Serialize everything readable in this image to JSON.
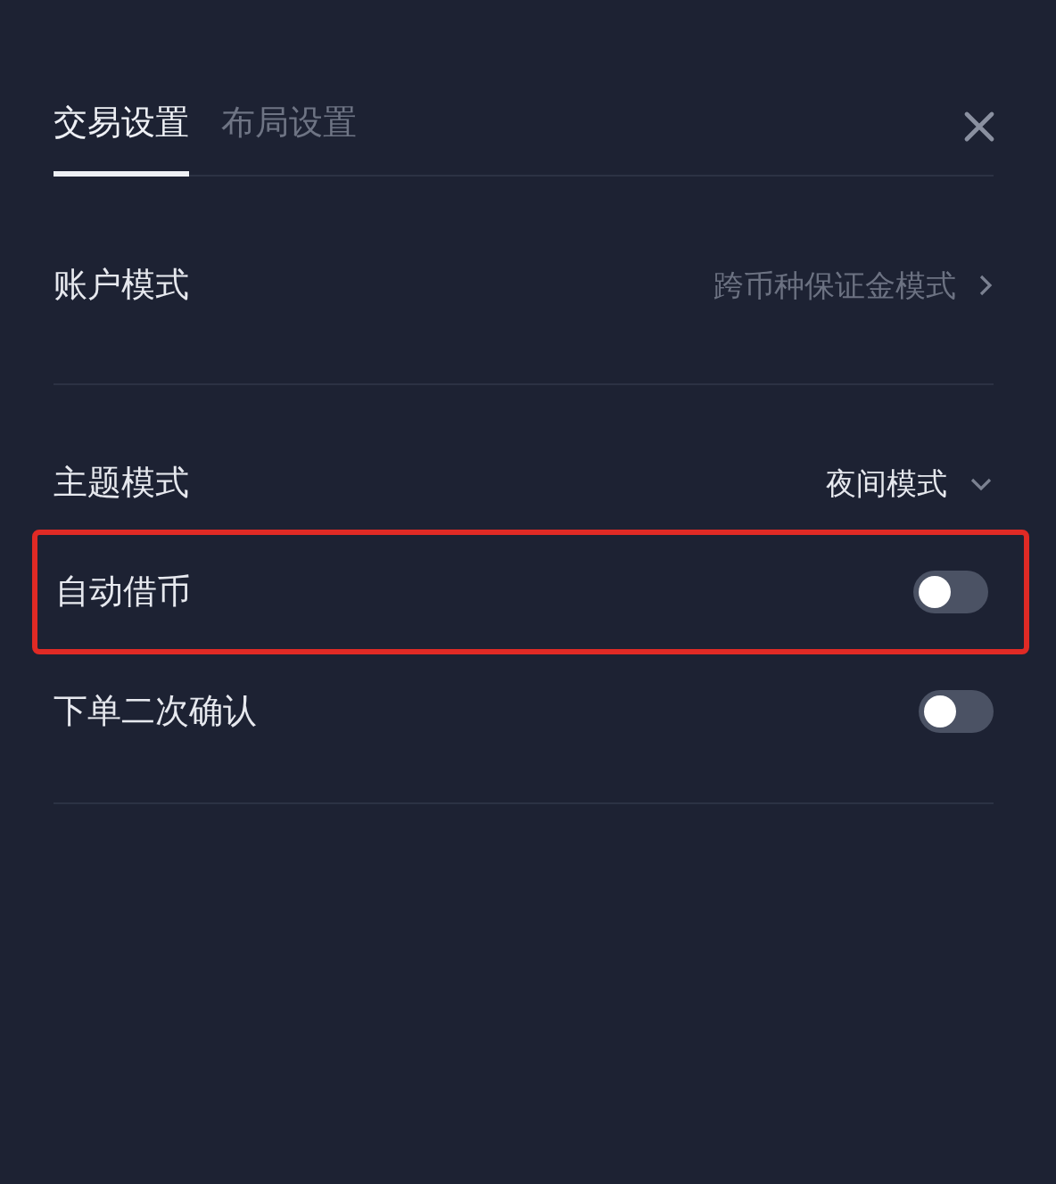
{
  "tabs": [
    {
      "label": "交易设置",
      "selected": true
    },
    {
      "label": "布局设置",
      "selected": false
    }
  ],
  "sections": [
    {
      "rows": [
        {
          "kind": "link",
          "label": "账户模式",
          "value": "跨币种保证金模式",
          "highlighted": false
        }
      ]
    },
    {
      "rows": [
        {
          "kind": "dropdown",
          "label": "主题模式",
          "value": "夜间模式",
          "highlighted": false
        },
        {
          "kind": "toggle",
          "label": "自动借币",
          "on": false,
          "highlighted": true
        },
        {
          "kind": "toggle",
          "label": "下单二次确认",
          "on": false,
          "highlighted": false
        }
      ]
    }
  ]
}
